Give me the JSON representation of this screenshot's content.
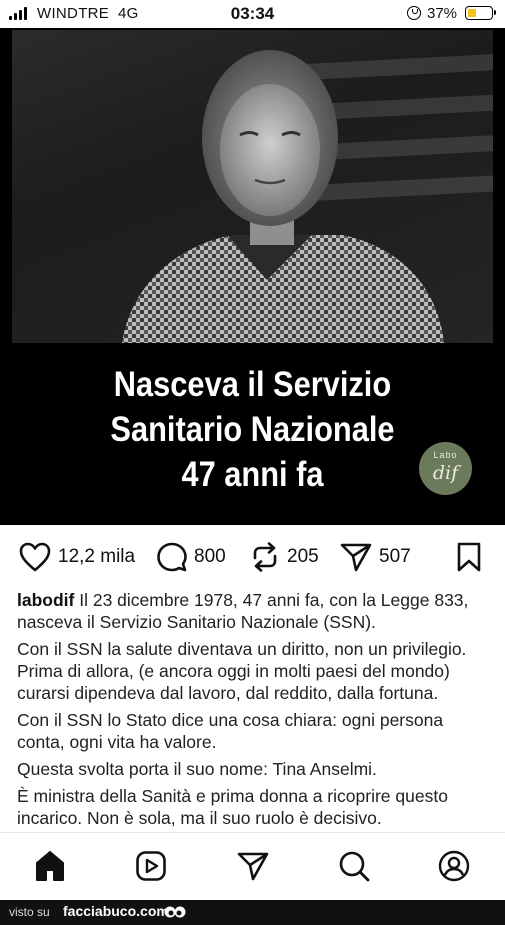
{
  "status_bar": {
    "carrier": "WINDTRE",
    "network": "4G",
    "time": "03:34",
    "battery_percent": "37%",
    "battery_level": 0.37,
    "battery_color": "#f4c21a"
  },
  "post": {
    "headline_lines": [
      "Nasceva il Servizio",
      "Sanitario Nazionale",
      "47 anni fa"
    ],
    "logo": {
      "top_text": "Labo",
      "mark": "dif"
    },
    "actions": {
      "likes": "12,2 mila",
      "comments": "800",
      "reposts": "205",
      "shares": "507"
    },
    "caption": {
      "username": "labodif",
      "paragraphs": [
        " Il 23 dicembre 1978, 47 anni fa, con la Legge 833, nasceva il Servizio Sanitario Nazionale (SSN).",
        "Con il SSN la salute diventava un diritto, non un privilegio. Prima di allora, (e ancora oggi in molti paesi del mondo) curarsi dipendeva dal lavoro, dal reddito, dalla fortuna.",
        "Con il SSN lo Stato dice una cosa chiara: ogni persona conta, ogni vita ha valore.",
        "Questa svolta porta il suo nome: Tina Anselmi.",
        "È ministra della Sanità e prima donna a ricoprire questo incarico. Non è sola, ma il suo ruolo è decisivo."
      ]
    }
  },
  "nav": {
    "icons": [
      "home-icon",
      "reels-icon",
      "send-icon",
      "search-icon",
      "profile-icon"
    ]
  },
  "footer": {
    "label": "visto su",
    "site": "facciabuco.com"
  }
}
